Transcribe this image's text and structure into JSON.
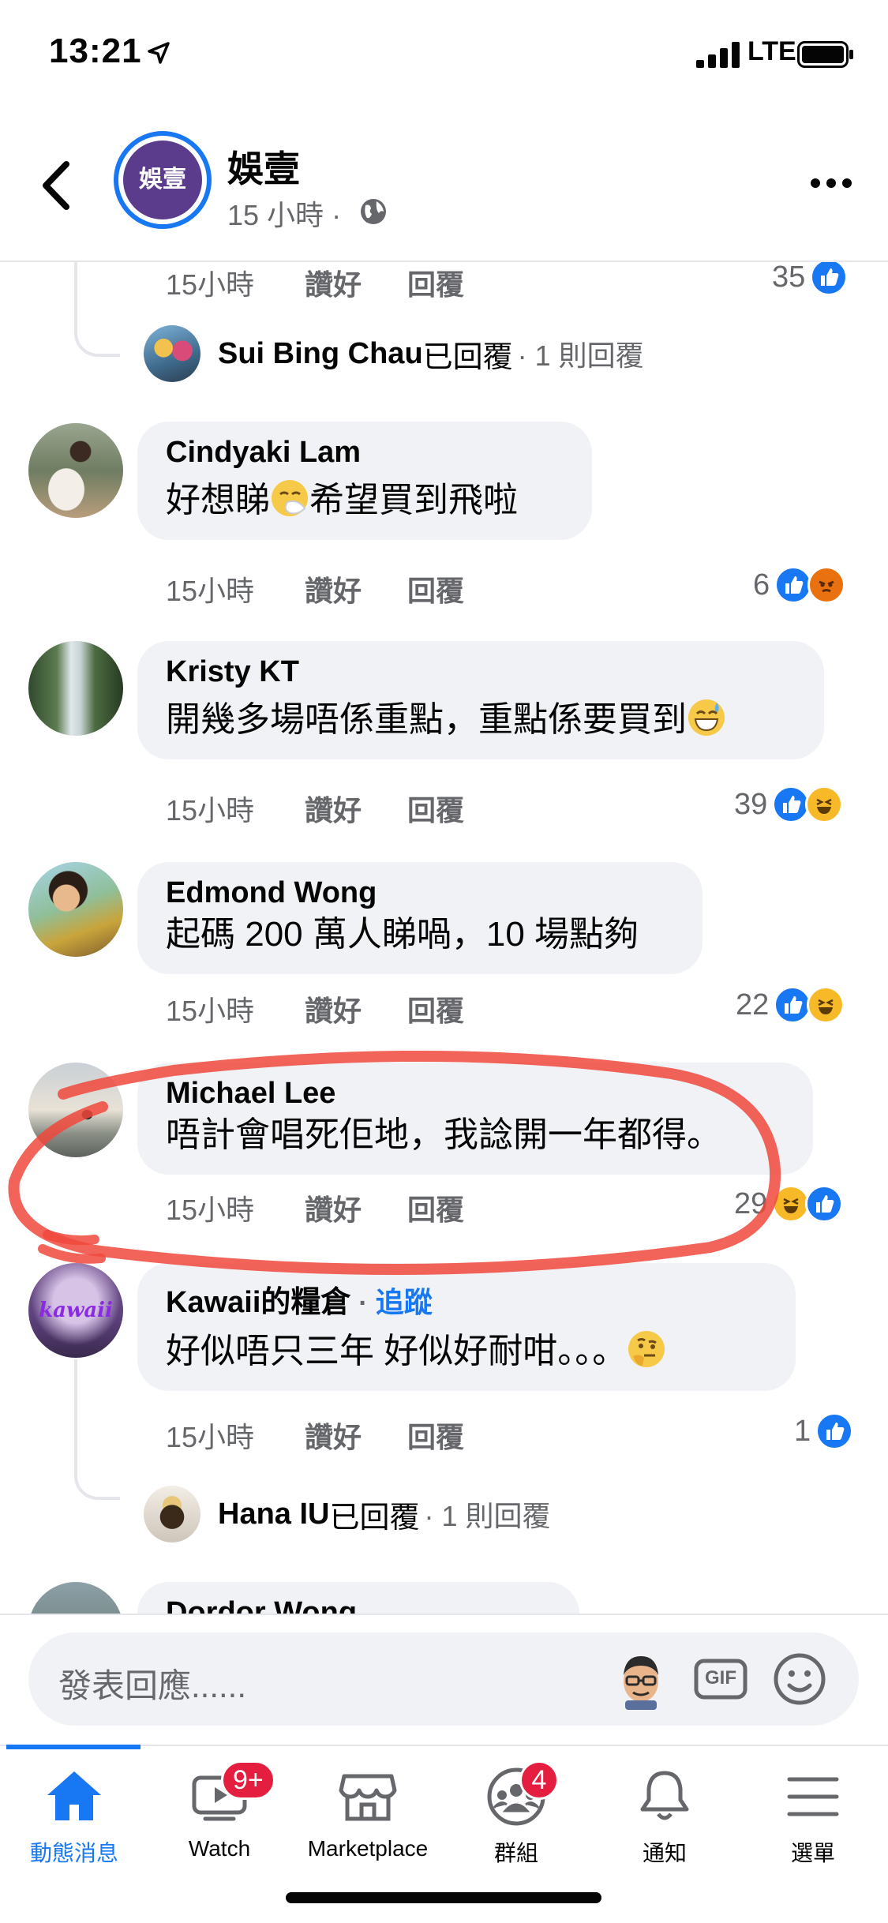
{
  "status_bar": {
    "time": "13:21",
    "network": "LTE"
  },
  "header": {
    "page_name": "娛壹",
    "page_avatar_text": "娛壹",
    "post_time": "15 小時",
    "separator": "·"
  },
  "comment_actions": {
    "like": "讚好",
    "reply": "回覆"
  },
  "thread_top": {
    "time": "15小時",
    "reactions": "35",
    "reply_summary": {
      "name": "Sui Bing Chau",
      "label": "已回覆",
      "count": "· 1 則回覆"
    }
  },
  "comments": [
    {
      "author": "Cindyaki Lam",
      "text_a": "好想睇",
      "text_b": "希望買到飛啦",
      "time": "15小時",
      "reactions": "6"
    },
    {
      "author": "Kristy KT",
      "text": "開幾多場唔係重點，重點係要買到",
      "time": "15小時",
      "reactions": "39"
    },
    {
      "author": "Edmond Wong",
      "text": "起碼 200 萬人睇喎，10 場點夠",
      "time": "15小時",
      "reactions": "22"
    },
    {
      "author": "Michael Lee",
      "text": "唔計會唱死佢地，我諗開一年都得。",
      "time": "15小時",
      "reactions": "29"
    },
    {
      "author": "Kawaii的糧倉",
      "follow": "追蹤",
      "dot": "·",
      "text": "好似唔只三年 好似好耐咁。。。",
      "time": "15小時",
      "reactions": "1",
      "reply_summary": {
        "name": "Hana IU",
        "label": "已回覆",
        "count": "· 1 則回覆"
      }
    },
    {
      "author": "Dordor Wong"
    }
  ],
  "composer": {
    "placeholder": "發表回應......",
    "gif_label": "GIF"
  },
  "tabs": [
    {
      "label": "動態消息",
      "icon": "home-icon",
      "active": true
    },
    {
      "label": "Watch",
      "icon": "watch-icon",
      "badge": "9+"
    },
    {
      "label": "Marketplace",
      "icon": "marketplace-icon"
    },
    {
      "label": "群組",
      "icon": "groups-icon",
      "badge": "4"
    },
    {
      "label": "通知",
      "icon": "bell-icon"
    },
    {
      "label": "選單",
      "icon": "menu-icon"
    }
  ],
  "colors": {
    "accent": "#1877f2",
    "annotation": "#f0483c",
    "badge": "#e41e3f",
    "bubble": "#f0f2f5"
  }
}
